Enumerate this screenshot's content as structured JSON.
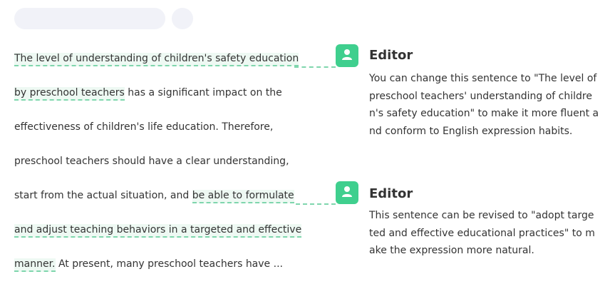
{
  "lines": [
    {
      "pre": "",
      "hl": "The level of understanding of children's safety education",
      "post": ""
    },
    {
      "pre": "",
      "hl": "by preschool teachers",
      "post": " has a significant impact on the"
    },
    {
      "pre": "effectiveness of children's life education. Therefore,",
      "hl": "",
      "post": ""
    },
    {
      "pre": "preschool teachers should have a clear understanding,",
      "hl": "",
      "post": ""
    },
    {
      "pre": "start from the actual situation, and ",
      "hl": "be able to formulate ",
      "post": ""
    },
    {
      "pre": "",
      "hl": "and adjust teaching behaviors in a targeted and effective",
      "post": ""
    },
    {
      "pre": "",
      "hl": "manner.",
      "post": " At present, many preschool teachers have ..."
    }
  ],
  "comments": [
    {
      "author": "Editor",
      "text": "You can change this sentence to \"The level of preschool teachers' understanding of children's safety education\" to make it more fluent and conform to English expression habits."
    },
    {
      "author": "Editor",
      "text": "This sentence can be revised to \"adopt targeted and effective educational practices\" to make the expression more natural."
    }
  ],
  "colors": {
    "accent": "#3fcf8e",
    "highlight_bg": "#eef9f3",
    "dash": "#7fd6ad",
    "skeleton": "#f1f2f8"
  }
}
